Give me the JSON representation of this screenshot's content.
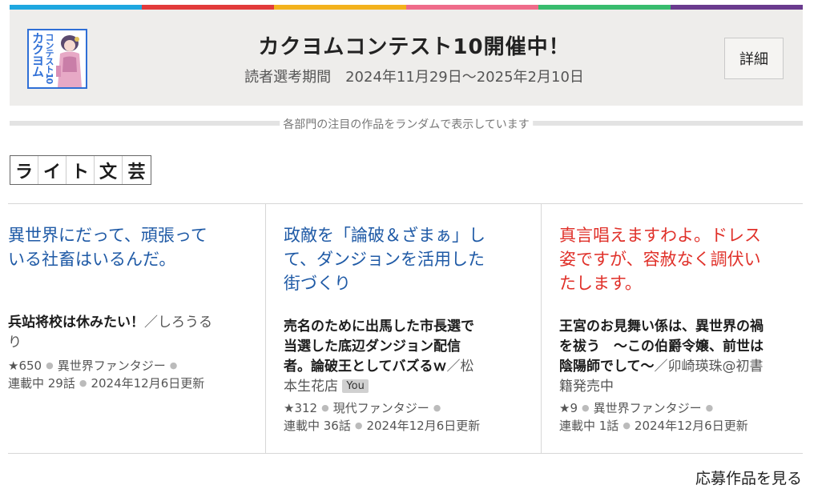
{
  "stripe_colors": [
    "#1ea7e0",
    "#e23b3b",
    "#f3b21d",
    "#ef6b8a",
    "#38bc6e",
    "#6a3b8e"
  ],
  "banner": {
    "logo_text_main": "カクヨム",
    "logo_text_sub": "コンテスト10",
    "title": "カクヨムコンテスト10開催中！",
    "subtitle": "読者選考期間　2024年11月29日〜2025年2月10日",
    "detail_label": "詳細"
  },
  "random_note": "各部門の注目の作品をランダムで表示しています",
  "genre_chars": [
    "ラ",
    "イ",
    "ト",
    "文",
    "芸"
  ],
  "works": [
    {
      "catch_lines": [
        "異世界にだって、頑張って",
        "いる社畜はいるんだ。"
      ],
      "catch_color": "#1f5aa6",
      "title_lines": [
        "兵站将校は休みたい！"
      ],
      "author_first": "／しろうる",
      "author_rest": "り",
      "you": "",
      "stars": "★650",
      "genre": "異世界ファンタジー",
      "status": "連載中 29話",
      "updated": "2024年12月6日更新"
    },
    {
      "catch_lines": [
        "政敵を「論破＆ざまぁ」し",
        "て、ダンジョンを活用した",
        "街づくり"
      ],
      "catch_color": "#1f5aa6",
      "title_lines": [
        "売名のために出馬した市長選で",
        "当選した底辺ダンジョン配信",
        "者。論破王としてバズるｗ"
      ],
      "author_first": "／松",
      "author_rest": "本生花店",
      "you": "You",
      "stars": "★312",
      "genre": "現代ファンタジー",
      "status": "連載中 36話",
      "updated": "2024年12月6日更新"
    },
    {
      "catch_lines": [
        "真言唱えますわよ。ドレス",
        "姿ですが、容赦なく調伏い",
        "たします。"
      ],
      "catch_color": "#e0312a",
      "title_lines": [
        "王宮のお見舞い係は、異世界の禍",
        "を祓う　～この伯爵令嬢、前世は",
        "陰陽師でして～"
      ],
      "author_first": "／卯崎瑛珠@初書",
      "author_rest": "籍発売中",
      "you": "",
      "stars": "★9",
      "genre": "異世界ファンタジー",
      "status": "連載中 1話",
      "updated": "2024年12月6日更新"
    }
  ],
  "see_more": "応募作品を見る"
}
